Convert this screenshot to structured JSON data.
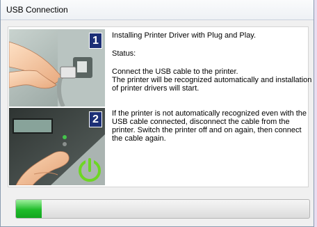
{
  "window": {
    "title": "USB Connection"
  },
  "steps": [
    {
      "number": "1",
      "illustration": "usb-cable-plug-icon"
    },
    {
      "number": "2",
      "illustration": "power-button-icon"
    }
  ],
  "content": {
    "installing": "Installing Printer Driver with Plug and Play.",
    "status_label": "Status:",
    "paragraph1": [
      "Connect the USB cable to the printer.",
      "The printer will be recognized automatically and installation",
      "of printer drivers will start."
    ],
    "paragraph2": [
      "If the printer is not automatically recognized even with the",
      "USB cable connected, disconnect the cable from the",
      "printer. Switch the printer off and on again, then connect",
      "the cable again."
    ]
  },
  "progress": {
    "fraction": 0.087,
    "color": "#1fbc2a"
  },
  "colors": {
    "step_badge": "#1c2f76",
    "power_icon": "#6ed624"
  }
}
